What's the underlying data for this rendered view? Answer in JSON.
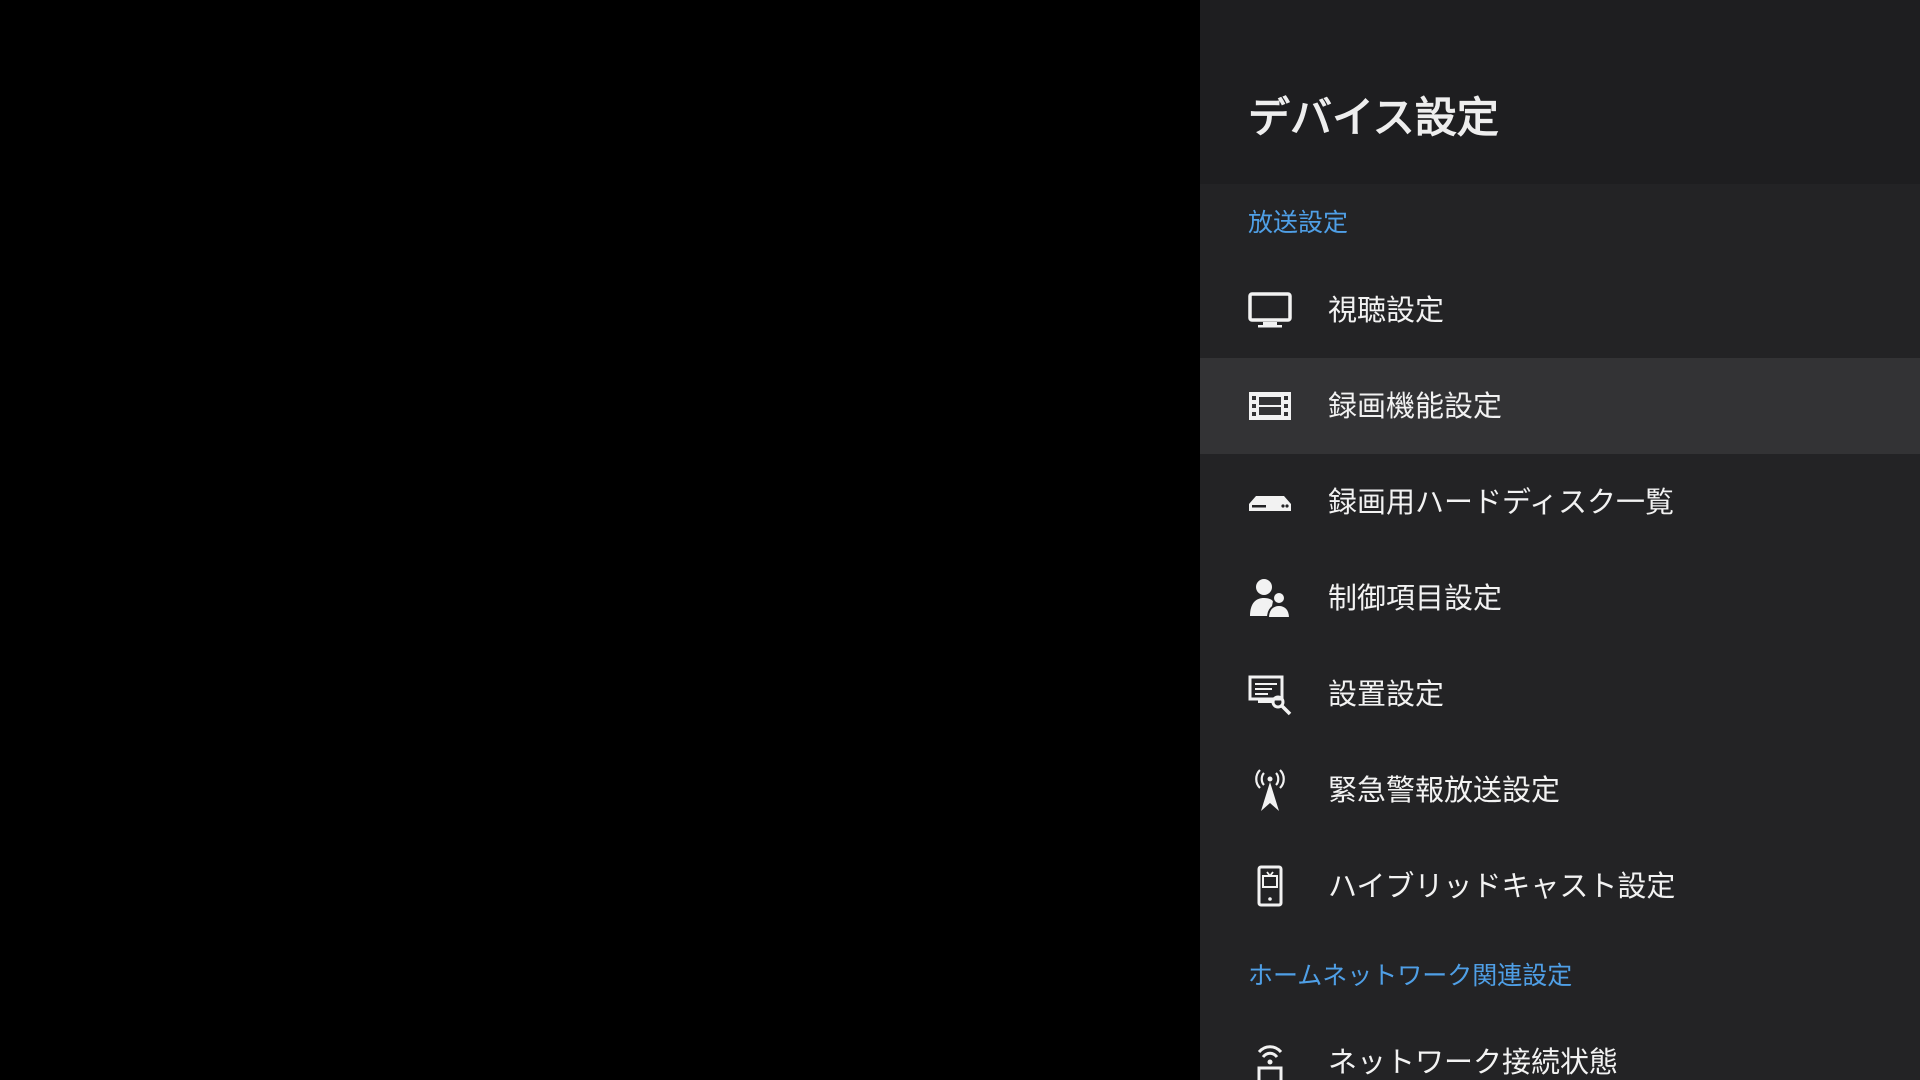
{
  "panel": {
    "title": "デバイス設定"
  },
  "colors": {
    "panel_background": "#232325",
    "header_background": "#1e1e20",
    "selected_background": "#333335",
    "section_accent": "#4f9fe6",
    "text": "#f2f2f2"
  },
  "sections": [
    {
      "label": "放送設定",
      "items": [
        {
          "label": "視聴設定",
          "icon": "tv-icon",
          "selected": false
        },
        {
          "label": "録画機能設定",
          "icon": "film-icon",
          "selected": true
        },
        {
          "label": "録画用ハードディスク一覧",
          "icon": "hard-disk-icon",
          "selected": false
        },
        {
          "label": "制御項目設定",
          "icon": "users-icon",
          "selected": false
        },
        {
          "label": "設置設定",
          "icon": "setup-tools-icon",
          "selected": false
        },
        {
          "label": "緊急警報放送設定",
          "icon": "broadcast-tower-icon",
          "selected": false
        },
        {
          "label": "ハイブリッドキャスト設定",
          "icon": "smartphone-tv-icon",
          "selected": false
        }
      ]
    },
    {
      "label": "ホームネットワーク関連設定",
      "items": [
        {
          "label": "ネットワーク接続状態",
          "icon": "network-status-icon",
          "selected": false
        }
      ]
    }
  ]
}
